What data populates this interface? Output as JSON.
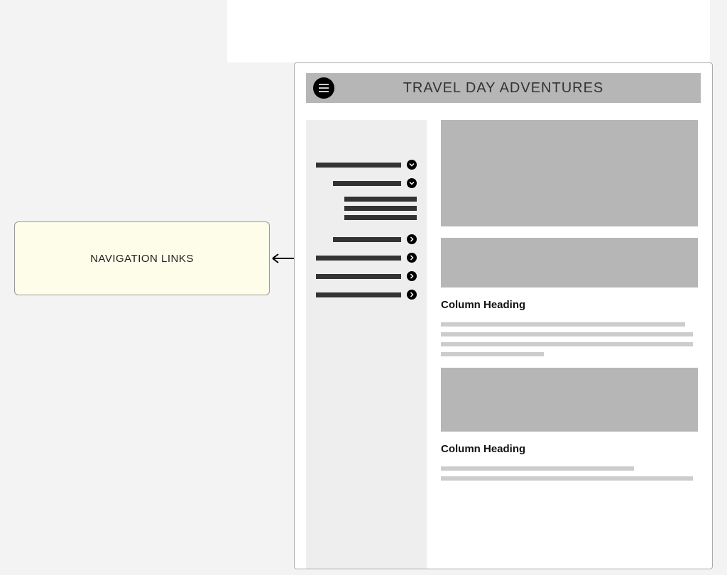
{
  "callout": {
    "label": "NAVIGATION LINKS"
  },
  "wireframe": {
    "title": "TRAVEL DAY ADVENTURES",
    "column_heading_1": "Column Heading",
    "column_heading_2": "Column Heading"
  },
  "icons": {
    "hamburger": "hamburger-menu-icon",
    "chevron_down": "chevron-down-icon",
    "chevron_right": "chevron-right-icon"
  },
  "nav": {
    "items": [
      {
        "type": "top",
        "expand": "down"
      },
      {
        "type": "top-indent",
        "expand": "down"
      },
      {
        "type": "subgroup",
        "lines": 3
      },
      {
        "type": "top-indent",
        "expand": "right"
      },
      {
        "type": "top",
        "expand": "right"
      },
      {
        "type": "top",
        "expand": "right"
      },
      {
        "type": "top",
        "expand": "right"
      }
    ]
  }
}
